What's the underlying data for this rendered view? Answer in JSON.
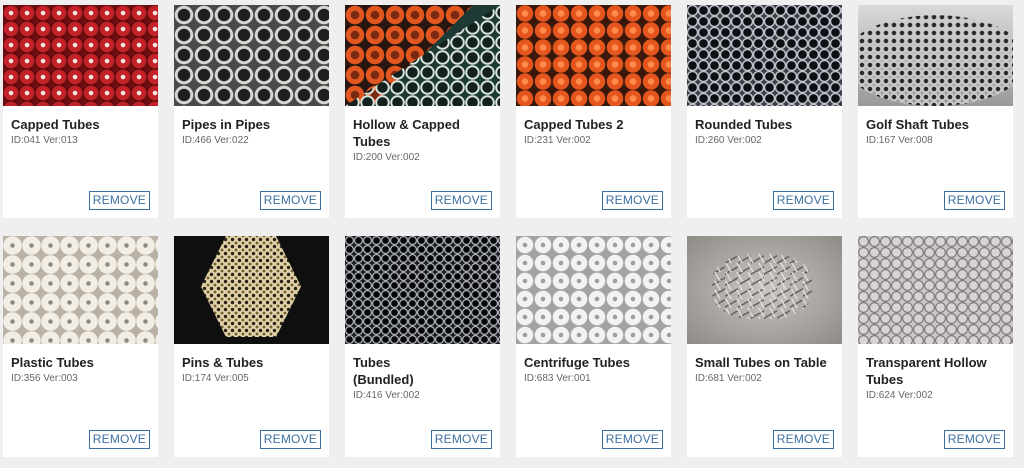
{
  "remove_label": "REMOVE",
  "items": [
    {
      "title": "Capped Tubes",
      "meta": "ID:041 Ver:013",
      "thumb": "red-capped-tubes"
    },
    {
      "title": "Pipes in Pipes",
      "meta": "ID:466 Ver:022",
      "thumb": "grey-nested-pipes"
    },
    {
      "title": "Hollow & Capped Tubes",
      "meta": "ID:200 Ver:002",
      "thumb": "orange-and-green-tubes"
    },
    {
      "title": "Capped Tubes 2",
      "meta": "ID:231 Ver:002",
      "thumb": "orange-capped-tubes"
    },
    {
      "title": "Rounded Tubes",
      "meta": "ID:260 Ver:002",
      "thumb": "dark-rounded-tubes"
    },
    {
      "title": "Golf Shaft Tubes",
      "meta": "ID:167 Ver:008",
      "thumb": "metal-golf-shafts"
    },
    {
      "title": "Plastic Tubes",
      "meta": "ID:356 Ver:003",
      "thumb": "white-plastic-tubes"
    },
    {
      "title": "Pins & Tubes",
      "meta": "ID:174 Ver:005",
      "thumb": "brass-pins-hexagon"
    },
    {
      "title": "Tubes (Bundled)",
      "meta": "ID:416 Ver:002",
      "thumb": "bundled-dark-tubes"
    },
    {
      "title": "Centrifuge Tubes",
      "meta": "ID:683 Ver:001",
      "thumb": "white-centrifuge-tubes"
    },
    {
      "title": "Small Tubes on Table",
      "meta": "ID:681 Ver:002",
      "thumb": "small-metal-tubes"
    },
    {
      "title": "Transparent Hollow Tubes",
      "meta": "ID:624 Ver:002",
      "thumb": "transparent-tubes"
    }
  ]
}
